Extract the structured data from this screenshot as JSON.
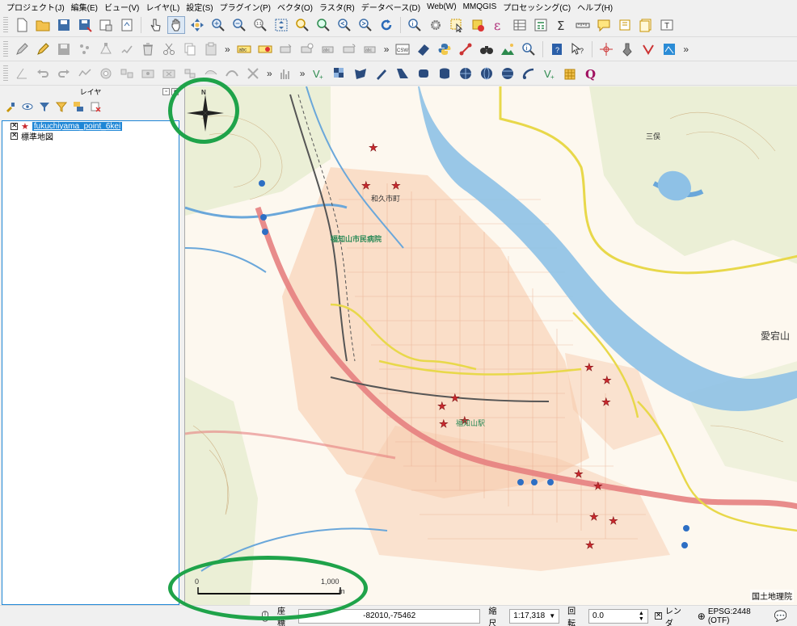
{
  "menu": [
    "プロジェクト(J)",
    "編集(E)",
    "ビュー(V)",
    "レイヤ(L)",
    "設定(S)",
    "プラグイン(P)",
    "ベクタ(O)",
    "ラスタ(R)",
    "データベース(D)",
    "Web(W)",
    "MMQGIS",
    "プロセッシング(C)",
    "ヘルプ(H)"
  ],
  "layers_panel": {
    "title": "レイヤ",
    "layers": [
      {
        "name": "fukuchiyama_point_6kei",
        "checked": true,
        "selected": true
      },
      {
        "name": "標準地図",
        "checked": true,
        "selected": false
      }
    ]
  },
  "map": {
    "north_label": "N",
    "scale_zero": "0",
    "scale_end": "1,000",
    "scale_unit": "m",
    "credit": "国土地理院",
    "place_labels": {
      "station": "福知山駅",
      "school": "和久市町",
      "east": "三俣",
      "mountain": "愛宕山",
      "hospital": "福知山市民病院"
    }
  },
  "statusbar": {
    "coord_label": "座標",
    "coord_value": "-82010,-75462",
    "scale_label": "縮尺",
    "scale_value": "1:17,318",
    "rotation_label": "回転",
    "rotation_value": "0.0",
    "render_label": "レンダ",
    "crs": "EPSG:2448 (OTF)"
  },
  "colors": {
    "accent": "#1e86d6",
    "annotation": "#1fa34a",
    "star": "#c8282d"
  }
}
